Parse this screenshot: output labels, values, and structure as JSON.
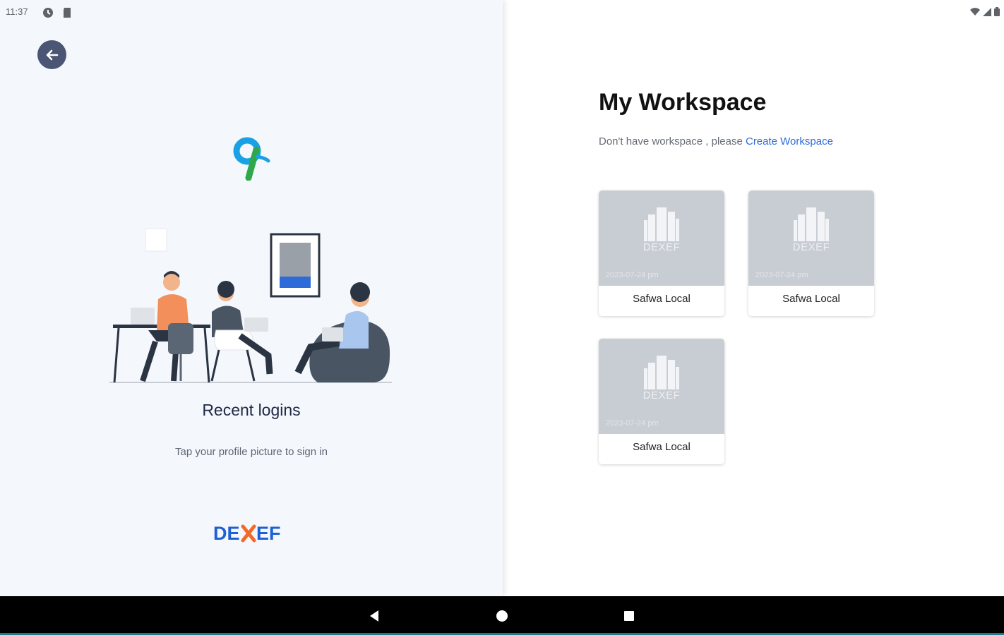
{
  "status_bar": {
    "time": "11:37"
  },
  "left_panel": {
    "recent_title": "Recent logins",
    "recent_subtitle": "Tap your profile picture to sign in",
    "brand": "DEXEF"
  },
  "workspace": {
    "title": "My Workspace",
    "subtitle_prefix": "Don't have workspace , please ",
    "create_link": "Create Workspace",
    "cards": [
      {
        "brand": "DEXEF",
        "date": "2023-07-24 pm",
        "name": "Safwa Local"
      },
      {
        "brand": "DEXEF",
        "date": "2023-07-24 pm",
        "name": "Safwa Local"
      },
      {
        "brand": "DEXEF",
        "date": "2023-07-24 pm",
        "name": "Safwa Local"
      }
    ]
  },
  "colors": {
    "accent_blue": "#2f6bd8",
    "brand_orange": "#f06a2a",
    "back_button": "#4a5673",
    "card_placeholder": "#c8ccd3"
  },
  "icons": {
    "back": "arrow-left-icon",
    "card": "building-icon",
    "nav_back": "triangle-back-icon",
    "nav_home": "circle-home-icon",
    "nav_recents": "square-recents-icon"
  }
}
